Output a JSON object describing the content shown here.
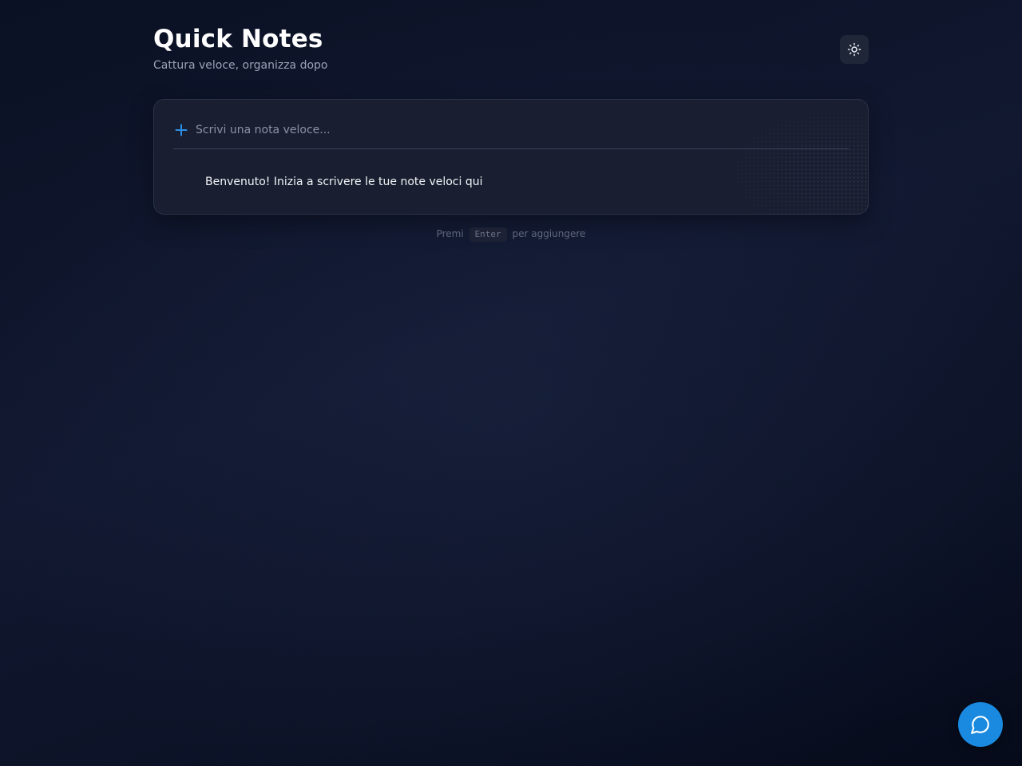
{
  "app": {
    "title": "Quick Notes",
    "subtitle": "Cattura veloce, organizza dopo"
  },
  "theme_toggle": {
    "icon": "sun-icon"
  },
  "composer": {
    "icon": "plus-icon",
    "placeholder": "Scrivi una nota veloce...",
    "value": ""
  },
  "notes": [
    {
      "text": "Benvenuto! Inizia a scrivere le tue note veloci qui"
    }
  ],
  "hint": {
    "prefix": "Premi",
    "key": "Enter",
    "suffix": "per aggiungere"
  },
  "chat_button": {
    "icon": "chat-bubble-icon"
  },
  "colors": {
    "accent": "#1a8ae0",
    "background": "#0f1529",
    "card": "#191f30",
    "text": "#ffffff",
    "muted": "#9aa3b8"
  }
}
